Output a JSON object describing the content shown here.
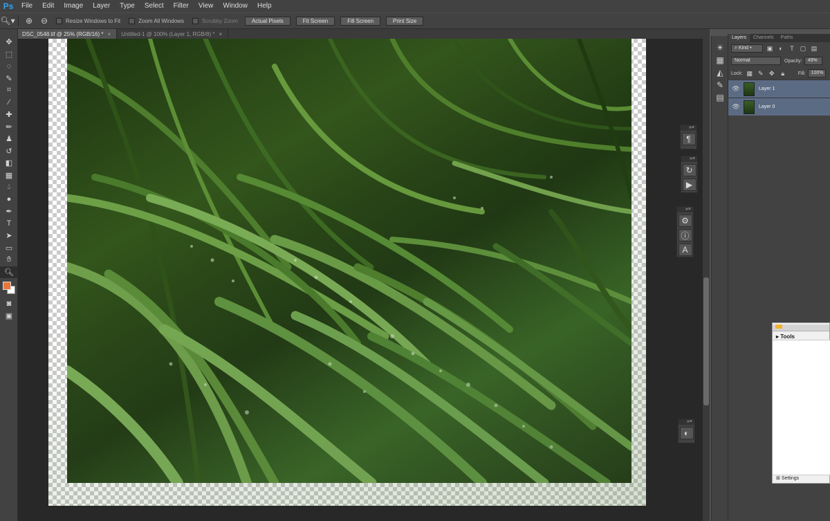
{
  "app": {
    "logo": "Ps"
  },
  "menu": [
    "File",
    "Edit",
    "Image",
    "Layer",
    "Type",
    "Select",
    "Filter",
    "View",
    "Window",
    "Help"
  ],
  "options_bar": {
    "tool_icon": "zoom-icon",
    "checkboxes": [
      {
        "label": "Resize Windows to Fit",
        "checked": false,
        "enabled": true
      },
      {
        "label": "Zoom All Windows",
        "checked": false,
        "enabled": true
      },
      {
        "label": "Scrubby Zoom",
        "checked": false,
        "enabled": false
      }
    ],
    "buttons": [
      "Actual Pixels",
      "Fit Screen",
      "Fill Screen",
      "Print Size"
    ]
  },
  "document_tabs": [
    {
      "title": "DSC_0548.tif @ 25% (RGB/16) *",
      "active": true
    },
    {
      "title": "Untitled-1 @ 100% (Layer 1, RGB/8) *",
      "active": false
    }
  ],
  "tools": [
    "move",
    "marquee",
    "lasso",
    "quick-select",
    "crop",
    "eyedropper",
    "healing",
    "brush",
    "clone",
    "history-brush",
    "eraser",
    "gradient",
    "blur",
    "dodge",
    "pen",
    "type",
    "path-select",
    "shape",
    "hand",
    "zoom"
  ],
  "colors": {
    "foreground": "#e8783a",
    "background": "#ffffff"
  },
  "layers_panel": {
    "tabs": [
      "Layers",
      "Channels",
      "Paths"
    ],
    "filter_kind": "Kind",
    "blend_mode": "Normal",
    "opacity_label": "Opacity:",
    "opacity": "49%",
    "lock_label": "Lock:",
    "fill_label": "Fill:",
    "fill": "100%",
    "layers": [
      {
        "name": "Layer 1",
        "visible": true,
        "selected": true
      },
      {
        "name": "Layer 0",
        "visible": true,
        "selected": true
      }
    ]
  },
  "tools_window": {
    "title": "Tools",
    "footer": "Settings"
  }
}
